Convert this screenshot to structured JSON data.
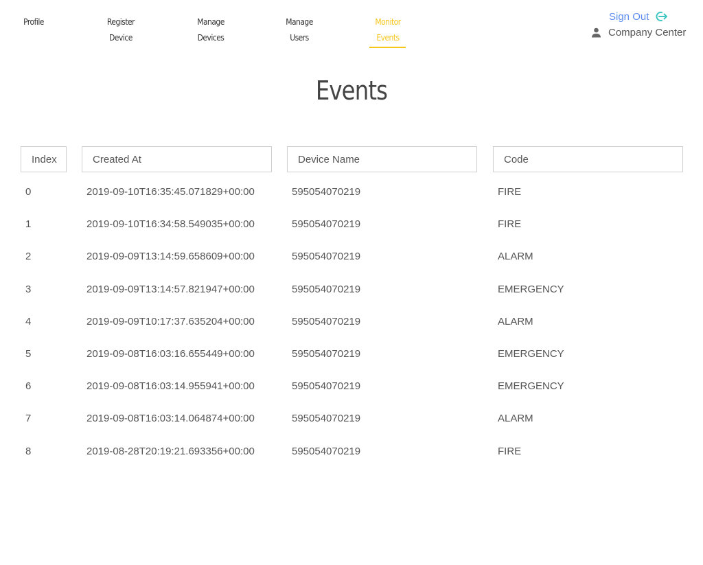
{
  "nav": {
    "items": [
      {
        "lines": [
          "Profile"
        ]
      },
      {
        "lines": [
          "Register",
          "Device"
        ]
      },
      {
        "lines": [
          "Manage",
          "Devices"
        ]
      },
      {
        "lines": [
          "Manage",
          "Users"
        ]
      },
      {
        "lines": [
          "Monitor",
          "Events"
        ],
        "active": true
      }
    ],
    "sign_out": "Sign Out",
    "company_center": "Company Center",
    "active_color": "#f5c518",
    "link_color": "#5b8def"
  },
  "page": {
    "title": "Events"
  },
  "table": {
    "columns": [
      "Index",
      "Created At",
      "Device Name",
      "Code"
    ],
    "rows": [
      [
        "0",
        "2019-09-10T16:35:45.071829+00:00",
        "595054070219",
        "FIRE"
      ],
      [
        "1",
        "2019-09-10T16:34:58.549035+00:00",
        "595054070219",
        "FIRE"
      ],
      [
        "2",
        "2019-09-09T13:14:59.658609+00:00",
        "595054070219",
        "ALARM"
      ],
      [
        "3",
        "2019-09-09T13:14:57.821947+00:00",
        "595054070219",
        "EMERGENCY"
      ],
      [
        "4",
        "2019-09-09T10:17:37.635204+00:00",
        "595054070219",
        "ALARM"
      ],
      [
        "5",
        "2019-09-08T16:03:16.655449+00:00",
        "595054070219",
        "EMERGENCY"
      ],
      [
        "6",
        "2019-09-08T16:03:14.955941+00:00",
        "595054070219",
        "EMERGENCY"
      ],
      [
        "7",
        "2019-09-08T16:03:14.064874+00:00",
        "595054070219",
        "ALARM"
      ],
      [
        "8",
        "2019-08-28T20:19:21.693356+00:00",
        "595054070219",
        "FIRE"
      ]
    ]
  }
}
